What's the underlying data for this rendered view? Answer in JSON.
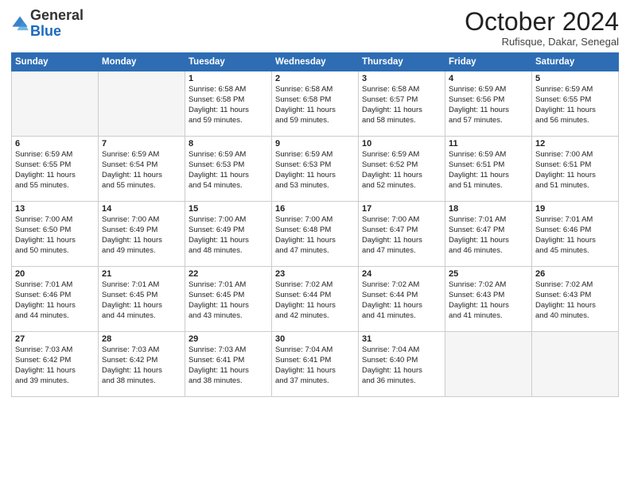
{
  "header": {
    "logo_general": "General",
    "logo_blue": "Blue",
    "month_title": "October 2024",
    "subtitle": "Rufisque, Dakar, Senegal"
  },
  "weekdays": [
    "Sunday",
    "Monday",
    "Tuesday",
    "Wednesday",
    "Thursday",
    "Friday",
    "Saturday"
  ],
  "weeks": [
    [
      {
        "day": "",
        "empty": true
      },
      {
        "day": "",
        "empty": true
      },
      {
        "day": "1",
        "sunrise": "Sunrise: 6:58 AM",
        "sunset": "Sunset: 6:58 PM",
        "daylight": "Daylight: 11 hours and 59 minutes."
      },
      {
        "day": "2",
        "sunrise": "Sunrise: 6:58 AM",
        "sunset": "Sunset: 6:58 PM",
        "daylight": "Daylight: 11 hours and 59 minutes."
      },
      {
        "day": "3",
        "sunrise": "Sunrise: 6:58 AM",
        "sunset": "Sunset: 6:57 PM",
        "daylight": "Daylight: 11 hours and 58 minutes."
      },
      {
        "day": "4",
        "sunrise": "Sunrise: 6:59 AM",
        "sunset": "Sunset: 6:56 PM",
        "daylight": "Daylight: 11 hours and 57 minutes."
      },
      {
        "day": "5",
        "sunrise": "Sunrise: 6:59 AM",
        "sunset": "Sunset: 6:55 PM",
        "daylight": "Daylight: 11 hours and 56 minutes."
      }
    ],
    [
      {
        "day": "6",
        "sunrise": "Sunrise: 6:59 AM",
        "sunset": "Sunset: 6:55 PM",
        "daylight": "Daylight: 11 hours and 55 minutes."
      },
      {
        "day": "7",
        "sunrise": "Sunrise: 6:59 AM",
        "sunset": "Sunset: 6:54 PM",
        "daylight": "Daylight: 11 hours and 55 minutes."
      },
      {
        "day": "8",
        "sunrise": "Sunrise: 6:59 AM",
        "sunset": "Sunset: 6:53 PM",
        "daylight": "Daylight: 11 hours and 54 minutes."
      },
      {
        "day": "9",
        "sunrise": "Sunrise: 6:59 AM",
        "sunset": "Sunset: 6:53 PM",
        "daylight": "Daylight: 11 hours and 53 minutes."
      },
      {
        "day": "10",
        "sunrise": "Sunrise: 6:59 AM",
        "sunset": "Sunset: 6:52 PM",
        "daylight": "Daylight: 11 hours and 52 minutes."
      },
      {
        "day": "11",
        "sunrise": "Sunrise: 6:59 AM",
        "sunset": "Sunset: 6:51 PM",
        "daylight": "Daylight: 11 hours and 51 minutes."
      },
      {
        "day": "12",
        "sunrise": "Sunrise: 7:00 AM",
        "sunset": "Sunset: 6:51 PM",
        "daylight": "Daylight: 11 hours and 51 minutes."
      }
    ],
    [
      {
        "day": "13",
        "sunrise": "Sunrise: 7:00 AM",
        "sunset": "Sunset: 6:50 PM",
        "daylight": "Daylight: 11 hours and 50 minutes."
      },
      {
        "day": "14",
        "sunrise": "Sunrise: 7:00 AM",
        "sunset": "Sunset: 6:49 PM",
        "daylight": "Daylight: 11 hours and 49 minutes."
      },
      {
        "day": "15",
        "sunrise": "Sunrise: 7:00 AM",
        "sunset": "Sunset: 6:49 PM",
        "daylight": "Daylight: 11 hours and 48 minutes."
      },
      {
        "day": "16",
        "sunrise": "Sunrise: 7:00 AM",
        "sunset": "Sunset: 6:48 PM",
        "daylight": "Daylight: 11 hours and 47 minutes."
      },
      {
        "day": "17",
        "sunrise": "Sunrise: 7:00 AM",
        "sunset": "Sunset: 6:47 PM",
        "daylight": "Daylight: 11 hours and 47 minutes."
      },
      {
        "day": "18",
        "sunrise": "Sunrise: 7:01 AM",
        "sunset": "Sunset: 6:47 PM",
        "daylight": "Daylight: 11 hours and 46 minutes."
      },
      {
        "day": "19",
        "sunrise": "Sunrise: 7:01 AM",
        "sunset": "Sunset: 6:46 PM",
        "daylight": "Daylight: 11 hours and 45 minutes."
      }
    ],
    [
      {
        "day": "20",
        "sunrise": "Sunrise: 7:01 AM",
        "sunset": "Sunset: 6:46 PM",
        "daylight": "Daylight: 11 hours and 44 minutes."
      },
      {
        "day": "21",
        "sunrise": "Sunrise: 7:01 AM",
        "sunset": "Sunset: 6:45 PM",
        "daylight": "Daylight: 11 hours and 44 minutes."
      },
      {
        "day": "22",
        "sunrise": "Sunrise: 7:01 AM",
        "sunset": "Sunset: 6:45 PM",
        "daylight": "Daylight: 11 hours and 43 minutes."
      },
      {
        "day": "23",
        "sunrise": "Sunrise: 7:02 AM",
        "sunset": "Sunset: 6:44 PM",
        "daylight": "Daylight: 11 hours and 42 minutes."
      },
      {
        "day": "24",
        "sunrise": "Sunrise: 7:02 AM",
        "sunset": "Sunset: 6:44 PM",
        "daylight": "Daylight: 11 hours and 41 minutes."
      },
      {
        "day": "25",
        "sunrise": "Sunrise: 7:02 AM",
        "sunset": "Sunset: 6:43 PM",
        "daylight": "Daylight: 11 hours and 41 minutes."
      },
      {
        "day": "26",
        "sunrise": "Sunrise: 7:02 AM",
        "sunset": "Sunset: 6:43 PM",
        "daylight": "Daylight: 11 hours and 40 minutes."
      }
    ],
    [
      {
        "day": "27",
        "sunrise": "Sunrise: 7:03 AM",
        "sunset": "Sunset: 6:42 PM",
        "daylight": "Daylight: 11 hours and 39 minutes."
      },
      {
        "day": "28",
        "sunrise": "Sunrise: 7:03 AM",
        "sunset": "Sunset: 6:42 PM",
        "daylight": "Daylight: 11 hours and 38 minutes."
      },
      {
        "day": "29",
        "sunrise": "Sunrise: 7:03 AM",
        "sunset": "Sunset: 6:41 PM",
        "daylight": "Daylight: 11 hours and 38 minutes."
      },
      {
        "day": "30",
        "sunrise": "Sunrise: 7:04 AM",
        "sunset": "Sunset: 6:41 PM",
        "daylight": "Daylight: 11 hours and 37 minutes."
      },
      {
        "day": "31",
        "sunrise": "Sunrise: 7:04 AM",
        "sunset": "Sunset: 6:40 PM",
        "daylight": "Daylight: 11 hours and 36 minutes."
      },
      {
        "day": "",
        "empty": true
      },
      {
        "day": "",
        "empty": true
      }
    ]
  ]
}
